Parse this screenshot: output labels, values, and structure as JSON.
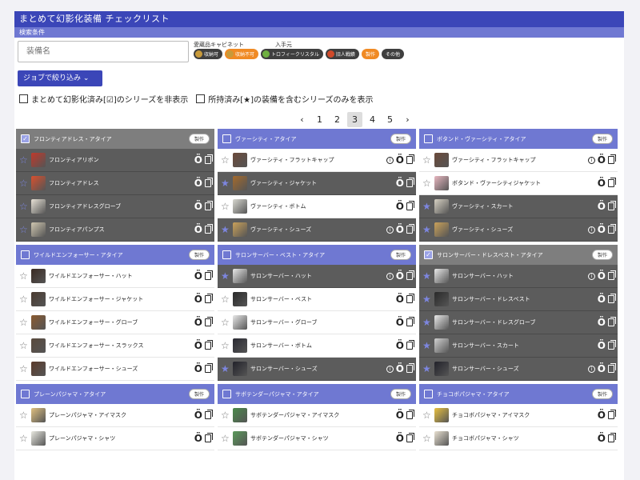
{
  "app": {
    "title": "まとめて幻影化装備 チェックリスト",
    "search_section": "検索条件"
  },
  "search": {
    "name_placeholder": "装備名"
  },
  "filters": {
    "cabinet_label": "愛蔵品キャビネット",
    "source_label": "入手元",
    "chips": [
      {
        "label": "収納可",
        "style": "dark",
        "icon_color": "#c89a3a"
      },
      {
        "label": "収納不可",
        "style": "orange",
        "icon_color": "#c89a3a"
      },
      {
        "label": "トロフィークリスタル",
        "style": "dark",
        "icon_color": "#6fb040"
      },
      {
        "label": "旧人戦績",
        "style": "dark",
        "icon_color": "#d04a2a"
      },
      {
        "label": "製作",
        "style": "orange",
        "icon_color": ""
      },
      {
        "label": "その他",
        "style": "dark",
        "icon_color": ""
      }
    ]
  },
  "job_button": "ジョブで絞り込み",
  "options": {
    "hide_completed": "まとめて幻影化済み[☑]のシリーズを非表示",
    "owned_only": "所持済み[★]の装備を含むシリーズのみを表示"
  },
  "pager": {
    "prev": "‹",
    "pages": [
      "1",
      "2",
      "3",
      "4",
      "5"
    ],
    "active": "3",
    "next": "›"
  },
  "make_label": "製作",
  "cards": [
    {
      "title": "フロンティアドレス・アタイア",
      "done": true,
      "items": [
        {
          "name": "フロンティアリボン",
          "owned": true,
          "star": false,
          "info": false,
          "color": "#c0392b"
        },
        {
          "name": "フロンティアドレス",
          "owned": true,
          "star": false,
          "info": false,
          "color": "#d9502e"
        },
        {
          "name": "フロンティアドレスグローブ",
          "owned": true,
          "star": false,
          "info": false,
          "color": "#e8e2d6"
        },
        {
          "name": "フロンティアパンプス",
          "owned": true,
          "star": false,
          "info": false,
          "color": "#cfc6b0"
        }
      ]
    },
    {
      "title": "ヴァーシティ・アタイア",
      "done": false,
      "items": [
        {
          "name": "ヴァーシティ・フラットキャップ",
          "owned": false,
          "star": false,
          "info": true,
          "color": "#6b4a3a"
        },
        {
          "name": "ヴァーシティ・ジャケット",
          "owned": true,
          "star": true,
          "info": false,
          "color": "#a46a2c"
        },
        {
          "name": "ヴァーシティ・ボトム",
          "owned": false,
          "star": false,
          "info": false,
          "color": "#d8d8d0"
        },
        {
          "name": "ヴァーシティ・シューズ",
          "owned": true,
          "star": true,
          "info": true,
          "color": "#c9a15a"
        }
      ]
    },
    {
      "title": "ボタンド・ヴァーシティ・アタイア",
      "done": false,
      "items": [
        {
          "name": "ヴァーシティ・フラットキャップ",
          "owned": false,
          "star": false,
          "info": true,
          "color": "#6b4a3a"
        },
        {
          "name": "ボタンド・ヴァーシティジャケット",
          "owned": false,
          "star": false,
          "info": false,
          "color": "#e8b7c0"
        },
        {
          "name": "ヴァーシティ・スカート",
          "owned": true,
          "star": true,
          "info": false,
          "color": "#d6d0c2"
        },
        {
          "name": "ヴァーシティ・シューズ",
          "owned": true,
          "star": true,
          "info": true,
          "color": "#c9a15a"
        }
      ]
    },
    {
      "title": "ワイルドエンフォーサー・アタイア",
      "done": false,
      "items": [
        {
          "name": "ワイルドエンフォーサー・ハット",
          "owned": false,
          "star": false,
          "info": false,
          "color": "#3a2a22"
        },
        {
          "name": "ワイルドエンフォーサー・ジャケット",
          "owned": false,
          "star": false,
          "info": false,
          "color": "#4a3a30"
        },
        {
          "name": "ワイルドエンフォーサー・グローブ",
          "owned": false,
          "star": false,
          "info": false,
          "color": "#8a5a30"
        },
        {
          "name": "ワイルドエンフォーサー・スラックス",
          "owned": false,
          "star": false,
          "info": false,
          "color": "#5a4a3c"
        },
        {
          "name": "ワイルドエンフォーサー・シューズ",
          "owned": false,
          "star": false,
          "info": false,
          "color": "#5a3a2a"
        }
      ]
    },
    {
      "title": "サロンサーバー・ベスト・アタイア",
      "done": false,
      "items": [
        {
          "name": "サロンサーバー・ハット",
          "owned": true,
          "star": true,
          "info": true,
          "color": "#e8e8e8"
        },
        {
          "name": "サロンサーバー・ベスト",
          "owned": false,
          "star": false,
          "info": false,
          "color": "#2a2a2a"
        },
        {
          "name": "サロンサーバー・グローブ",
          "owned": false,
          "star": false,
          "info": false,
          "color": "#e8e8e8"
        },
        {
          "name": "サロンサーバー・ボトム",
          "owned": false,
          "star": false,
          "info": false,
          "color": "#2a2a32"
        },
        {
          "name": "サロンサーバー・シューズ",
          "owned": true,
          "star": true,
          "info": true,
          "color": "#22222a"
        }
      ]
    },
    {
      "title": "サロンサーバー・ドレスベスト・アタイア",
      "done": true,
      "items": [
        {
          "name": "サロンサーバー・ハット",
          "owned": true,
          "star": true,
          "info": true,
          "color": "#e8e8e8"
        },
        {
          "name": "サロンサーバー・ドレスベスト",
          "owned": true,
          "star": true,
          "info": false,
          "color": "#2a2a2a"
        },
        {
          "name": "サロンサーバー・ドレスグローブ",
          "owned": true,
          "star": true,
          "info": false,
          "color": "#e8e8e8"
        },
        {
          "name": "サロンサーバー・スカート",
          "owned": true,
          "star": true,
          "info": false,
          "color": "#d0d0d0"
        },
        {
          "name": "サロンサーバー・シューズ",
          "owned": true,
          "star": true,
          "info": true,
          "color": "#22222a"
        }
      ]
    },
    {
      "title": "プレーンパジャマ・アタイア",
      "done": false,
      "items": [
        {
          "name": "プレーンパジャマ・アイマスク",
          "owned": false,
          "star": false,
          "info": false,
          "color": "#e0c080"
        },
        {
          "name": "プレーンパジャマ・シャツ",
          "owned": false,
          "star": false,
          "info": false,
          "color": "#e8e8e0"
        }
      ]
    },
    {
      "title": "サボテンダーパジャマ・アタイア",
      "done": false,
      "items": [
        {
          "name": "サボテンダーパジャマ・アイマスク",
          "owned": false,
          "star": false,
          "info": false,
          "color": "#4a8a4a"
        },
        {
          "name": "サボテンダーパジャマ・シャツ",
          "owned": false,
          "star": false,
          "info": false,
          "color": "#5a9a5a"
        }
      ]
    },
    {
      "title": "チョコボパジャマ・アタイア",
      "done": false,
      "items": [
        {
          "name": "チョコボパジャマ・アイマスク",
          "owned": false,
          "star": false,
          "info": false,
          "color": "#e8c040"
        },
        {
          "name": "チョコボパジャマ・シャツ",
          "owned": false,
          "star": false,
          "info": false,
          "color": "#e8e0d0"
        }
      ]
    }
  ]
}
